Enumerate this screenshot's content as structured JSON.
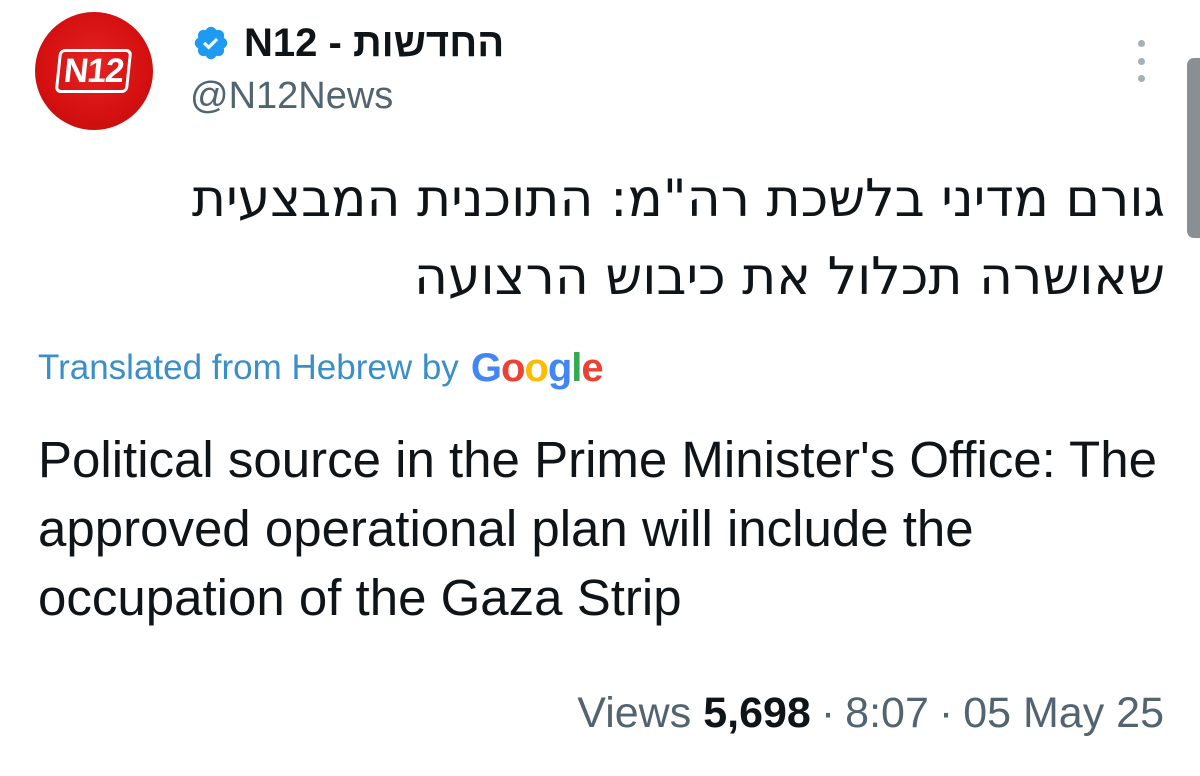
{
  "account": {
    "display_name": "החדשות - N12",
    "handle": "@N12News",
    "avatar_text": "N12",
    "verified": true
  },
  "tweet": {
    "hebrew_text": "גורם מדיני בלשכת רה\"מ: התוכנית המבצעית שאושרה תכלול את כיבוש הרצועה",
    "translated_label": "Translated from Hebrew by",
    "translator_logo": [
      "G",
      "o",
      "o",
      "g",
      "l",
      "e"
    ],
    "english_text": "Political source in the Prime Minister's Office: The approved operational plan will include the occupation of the Gaza Strip"
  },
  "meta": {
    "views_label": "Views",
    "views_count": "5,698",
    "separator": "·",
    "time": "8:07",
    "date": "05 May 25"
  },
  "icons": {
    "verified": "verified-badge-icon",
    "more": "more-options-icon"
  },
  "colors": {
    "avatar_red": "#d41010",
    "verified_blue": "#1d9bf0",
    "translate_link": "#3a8fc9",
    "secondary_text": "#536471",
    "primary_text": "#0f1419"
  }
}
